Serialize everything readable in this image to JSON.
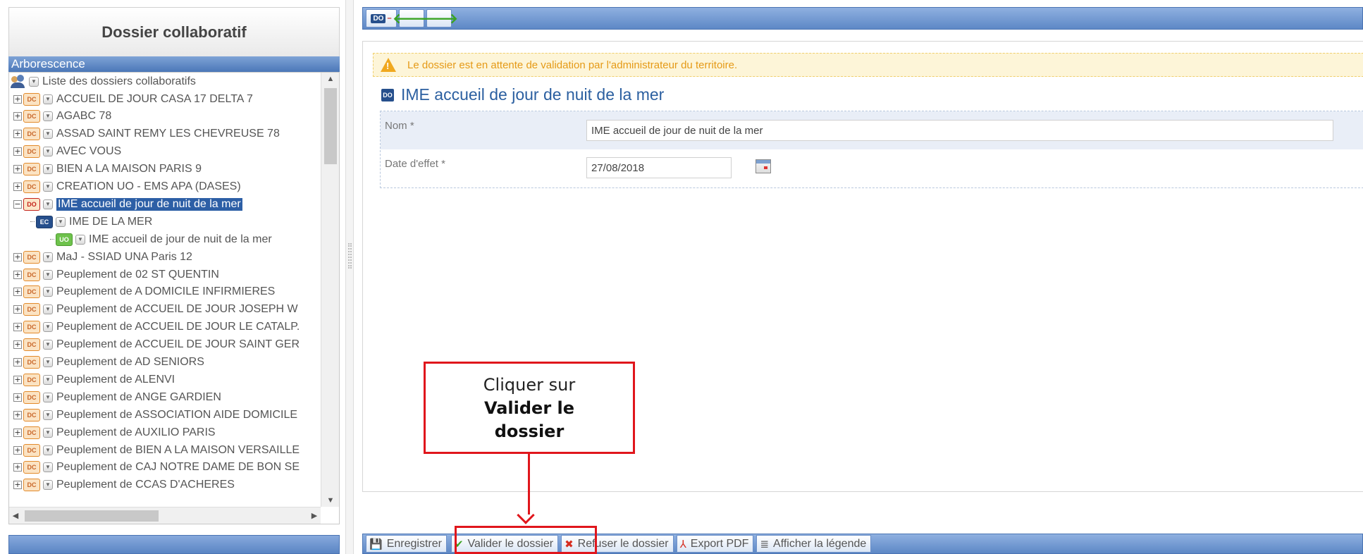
{
  "left_panel": {
    "title": "Dossier collaboratif",
    "tree_title": "Arborescence",
    "root_label": "Liste des dossiers collaboratifs",
    "items": [
      {
        "label": "ACCUEIL DE JOUR CASA 17 DELTA 7",
        "icon": "DC"
      },
      {
        "label": "AGABC 78",
        "icon": "DC"
      },
      {
        "label": "ASSAD SAINT REMY LES CHEVREUSE 78",
        "icon": "DC"
      },
      {
        "label": "AVEC VOUS",
        "icon": "DC"
      },
      {
        "label": "BIEN A LA MAISON PARIS 9",
        "icon": "DC"
      },
      {
        "label": "CREATION UO - EMS APA (DASES)",
        "icon": "DC"
      },
      {
        "label": "IME accueil de jour de nuit de la mer",
        "icon": "DO"
      },
      {
        "label": "IME DE LA MER",
        "icon": "EC"
      },
      {
        "label": "IME accueil de jour de nuit de la mer",
        "icon": "UO"
      },
      {
        "label": "MaJ - SSIAD UNA Paris 12",
        "icon": "DC"
      },
      {
        "label": "Peuplement de 02 ST QUENTIN",
        "icon": "DC"
      },
      {
        "label": "Peuplement de A DOMICILE INFIRMIERES",
        "icon": "DC"
      },
      {
        "label": "Peuplement de ACCUEIL DE JOUR JOSEPH W",
        "icon": "DC"
      },
      {
        "label": "Peuplement de ACCUEIL DE JOUR LE CATALP.",
        "icon": "DC"
      },
      {
        "label": "Peuplement de ACCUEIL DE JOUR SAINT GER",
        "icon": "DC"
      },
      {
        "label": "Peuplement de AD SENIORS",
        "icon": "DC"
      },
      {
        "label": "Peuplement de ALENVI",
        "icon": "DC"
      },
      {
        "label": "Peuplement de ANGE GARDIEN",
        "icon": "DC"
      },
      {
        "label": "Peuplement de ASSOCIATION AIDE DOMICILE",
        "icon": "DC"
      },
      {
        "label": "Peuplement de AUXILIO PARIS",
        "icon": "DC"
      },
      {
        "label": "Peuplement de BIEN A LA MAISON VERSAILLE",
        "icon": "DC"
      },
      {
        "label": "Peuplement de CAJ NOTRE DAME DE BON SE",
        "icon": "DC"
      },
      {
        "label": "Peuplement de CCAS D'ACHERES",
        "icon": "DC"
      }
    ]
  },
  "toolbar": {
    "doc_badge": "DO",
    "back_icon": "arrow-left-icon",
    "forward_icon": "arrow-right-icon"
  },
  "main": {
    "warning": "Le dossier est en attente de validation par l'administrateur du territoire.",
    "doc_icon": "DO",
    "doc_title": "IME accueil de jour de nuit de la mer",
    "form": {
      "nom_label": "Nom *",
      "nom_value": "IME accueil de jour de nuit de la mer",
      "date_label": "Date d'effet *",
      "date_value": "27/08/2018"
    }
  },
  "callout": {
    "line1": "Cliquer sur",
    "line2": "Valider le",
    "line3": "dossier"
  },
  "actions": {
    "save": "Enregistrer",
    "validate": "Valider le dossier",
    "refuse": "Refuser le dossier",
    "export": "Export PDF",
    "legend": "Afficher la légende"
  },
  "colors": {
    "accent_blue": "#5d88c6",
    "highlight_red": "#e0161c",
    "warning_orange": "#e59a17",
    "selected_bg": "#2d5fa6"
  }
}
